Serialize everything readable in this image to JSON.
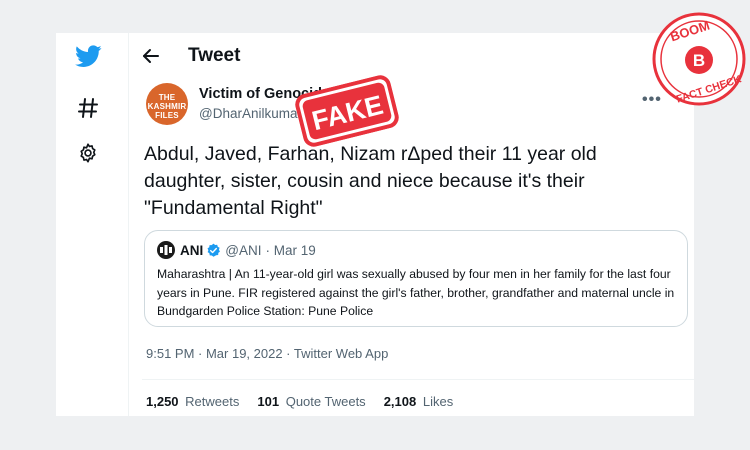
{
  "header": {
    "title": "Tweet"
  },
  "tweet": {
    "avatar_text": "THE KASHMIR FILES",
    "display_name": "Victim of Genocide",
    "handle": "@DharAnilkuma",
    "text": "Abdul, Javed, Farhan, Nizam rΔped their 11 year old daughter, sister, cousin and niece because it's their \"Fundamental Right\"",
    "timestamp": "9:51 PM · Mar 19, 2022 · Twitter Web App"
  },
  "quote": {
    "name": "ANI",
    "handle": "@ANI",
    "date": "· Mar 19",
    "text": "Maharashtra | An 11-year-old girl was sexually abused by four men in her family for the last four years in Pune. FIR registered against the girl's father, brother, grandfather and maternal uncle in Bundgarden Police Station: Pune Police"
  },
  "stats": {
    "retweets_count": "1,250",
    "retweets_label": "Retweets",
    "quotes_count": "101",
    "quotes_label": "Quote Tweets",
    "likes_count": "2,108",
    "likes_label": "Likes"
  },
  "overlay": {
    "stamp_text": "FAKE",
    "badge_top": "BOOM",
    "badge_letter": "B",
    "badge_bottom": "FACT CHECK"
  },
  "colors": {
    "twitter_blue": "#1d9bf0",
    "stamp_red": "#e8323c",
    "badge_red": "#e8323c"
  },
  "icons": [
    "twitter-logo-icon",
    "hashtag-icon",
    "gear-icon",
    "back-arrow-icon",
    "more-icon",
    "verified-icon"
  ]
}
